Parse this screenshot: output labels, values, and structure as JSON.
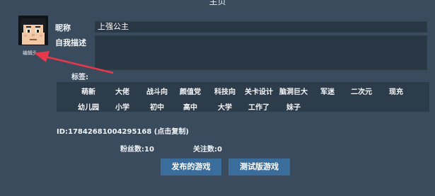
{
  "header": {
    "title": "主页"
  },
  "profile": {
    "avatar_edit_label": "编辑头",
    "nickname_label": "昵称",
    "nickname_value": "上强公主",
    "description_label": "自我描述",
    "description_value": ""
  },
  "tags": {
    "label": "标签:",
    "row1": [
      "萌新",
      "大佬",
      "战斗向",
      "颜值党",
      "科技向",
      "关卡设计",
      "脑洞巨大",
      "军迷",
      "二次元",
      "现充"
    ],
    "row2": [
      "幼儿园",
      "小学",
      "初中",
      "高中",
      "大学",
      "工作了",
      "妹子"
    ]
  },
  "account": {
    "id_text": "ID:17842681004295168 (点击复制)",
    "followers_text": "粉丝数:10",
    "following_text": "关注数:0"
  },
  "buttons": {
    "published_games": "发布的游戏",
    "beta_games": "测试版游戏"
  },
  "colors": {
    "background": "#394b5c",
    "field_bg": "#2a3744",
    "tag_panel_bg": "#2d3c4b",
    "button_bg": "#3a6c9c",
    "annotation_arrow": "#e8384a"
  }
}
